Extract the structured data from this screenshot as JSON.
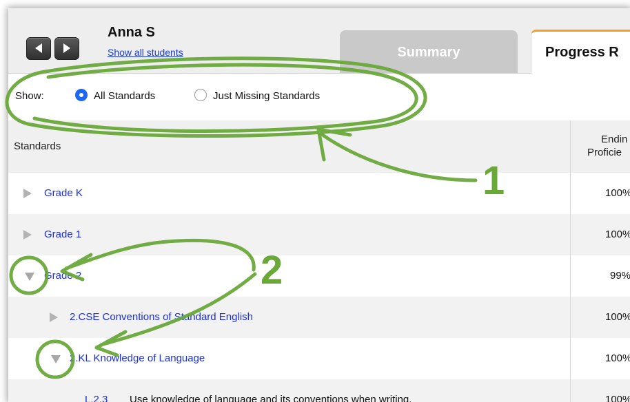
{
  "student": {
    "name": "Anna S",
    "show_all_link": "Show all students"
  },
  "tabs": {
    "summary": "Summary",
    "progress": "Progress R"
  },
  "filter": {
    "label": "Show:",
    "option_all": "All Standards",
    "option_missing": "Just Missing Standards",
    "selected": "All Standards"
  },
  "table": {
    "col_standards": "Standards",
    "col_ending_1": "Endin",
    "col_ending_2": "Proficie",
    "rows": [
      {
        "label": "Grade K",
        "value": "100%"
      },
      {
        "label": "Grade 1",
        "value": "100%"
      },
      {
        "label": "Grade 2",
        "value": "99%"
      },
      {
        "label": "2.CSE Conventions of Standard English",
        "value": "100%"
      },
      {
        "label": "2.KL Knowledge of Language",
        "value": "100%"
      },
      {
        "code": "L.2.3",
        "label": "Use knowledge of language and its conventions when writing,",
        "value": "100%"
      }
    ]
  },
  "annotations": {
    "callout_1": "1",
    "callout_2": "2"
  },
  "colors": {
    "annotation_green": "#6aa83a",
    "tab_accent": "#f0a020",
    "link_blue": "#1a2ee0",
    "radio_blue": "#1e66f5"
  }
}
